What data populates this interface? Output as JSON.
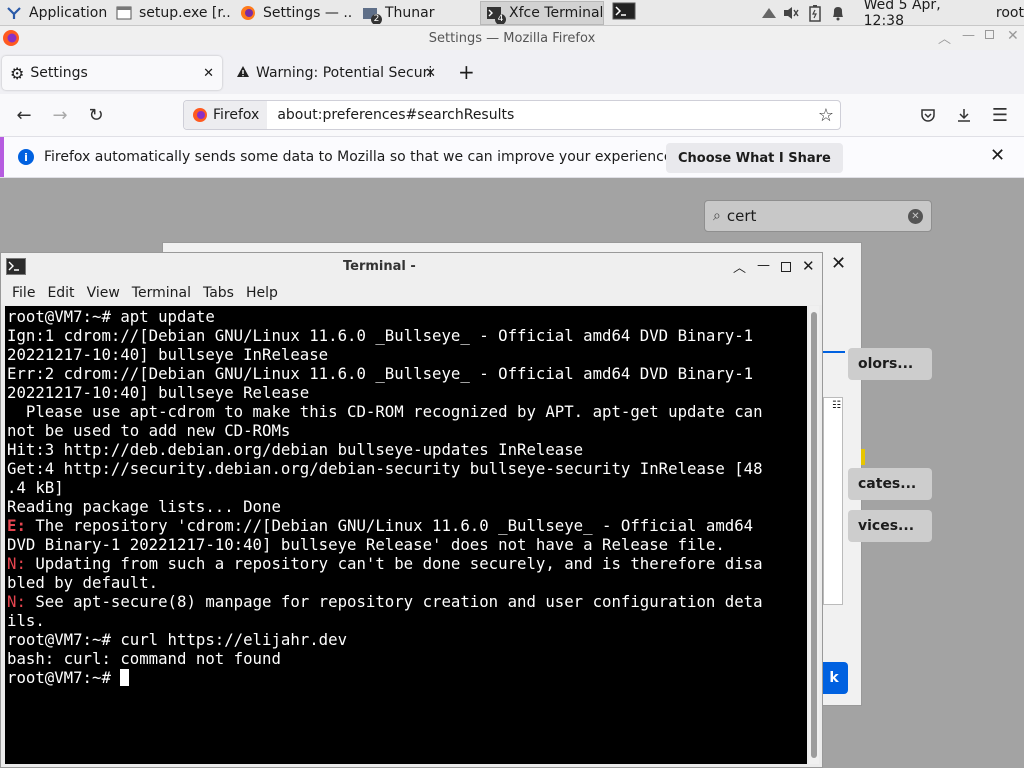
{
  "panel": {
    "tasks": [
      "Applications",
      "setup.exe [r...",
      "Settings — ...",
      "Thunar",
      "Xfce Terminal"
    ],
    "thunar_badge": "2",
    "terminal_badge": "4",
    "clock": "Wed  5 Apr, 12:38",
    "user": "root"
  },
  "firefox": {
    "window_title": "Settings — Mozilla Firefox",
    "tabs": [
      {
        "label": "Settings"
      },
      {
        "label": "Warning: Potential Securi"
      }
    ],
    "identity_label": "Firefox",
    "url": "about:preferences#searchResults",
    "notice_text": "Firefox automatically sends some data to Mozilla so that we can improve your experience.",
    "notice_button": "Choose What I Share",
    "search_value": "cert",
    "bg_buttons": [
      "olors...",
      "cates...",
      "vices..."
    ],
    "bg_ok": "k"
  },
  "terminal": {
    "title": "Terminal -",
    "menu": [
      "File",
      "Edit",
      "View",
      "Terminal",
      "Tabs",
      "Help"
    ],
    "lines": [
      {
        "t": "root@VM7:~# apt update"
      },
      {
        "t": "Ign:1 cdrom://[Debian GNU/Linux 11.6.0 _Bullseye_ - Official amd64 DVD Binary-1"
      },
      {
        "t": "20221217-10:40] bullseye InRelease"
      },
      {
        "t": "Err:2 cdrom://[Debian GNU/Linux 11.6.0 _Bullseye_ - Official amd64 DVD Binary-1"
      },
      {
        "t": "20221217-10:40] bullseye Release"
      },
      {
        "t": "  Please use apt-cdrom to make this CD-ROM recognized by APT. apt-get update can"
      },
      {
        "t": "not be used to add new CD-ROMs"
      },
      {
        "t": "Hit:3 http://deb.debian.org/debian bullseye-updates InRelease"
      },
      {
        "t": "Get:4 http://security.debian.org/debian-security bullseye-security InRelease [48"
      },
      {
        "t": ".4 kB]"
      },
      {
        "t": "Reading package lists... Done"
      },
      {
        "p": "E:",
        "c": "red",
        "t": " The repository 'cdrom://[Debian GNU/Linux 11.6.0 _Bullseye_ - Official amd64"
      },
      {
        "t": "DVD Binary-1 20221217-10:40] bullseye Release' does not have a Release file."
      },
      {
        "p": "N:",
        "c": "nred",
        "t": " Updating from such a repository can't be done securely, and is therefore disa"
      },
      {
        "t": "bled by default."
      },
      {
        "p": "N:",
        "c": "nred",
        "t": " See apt-secure(8) manpage for repository creation and user configuration deta"
      },
      {
        "t": "ils."
      },
      {
        "t": "root@VM7:~# curl https://elijahr.dev"
      },
      {
        "t": "bash: curl: command not found"
      },
      {
        "t": "root@VM7:~# ",
        "cursor": true
      }
    ]
  }
}
